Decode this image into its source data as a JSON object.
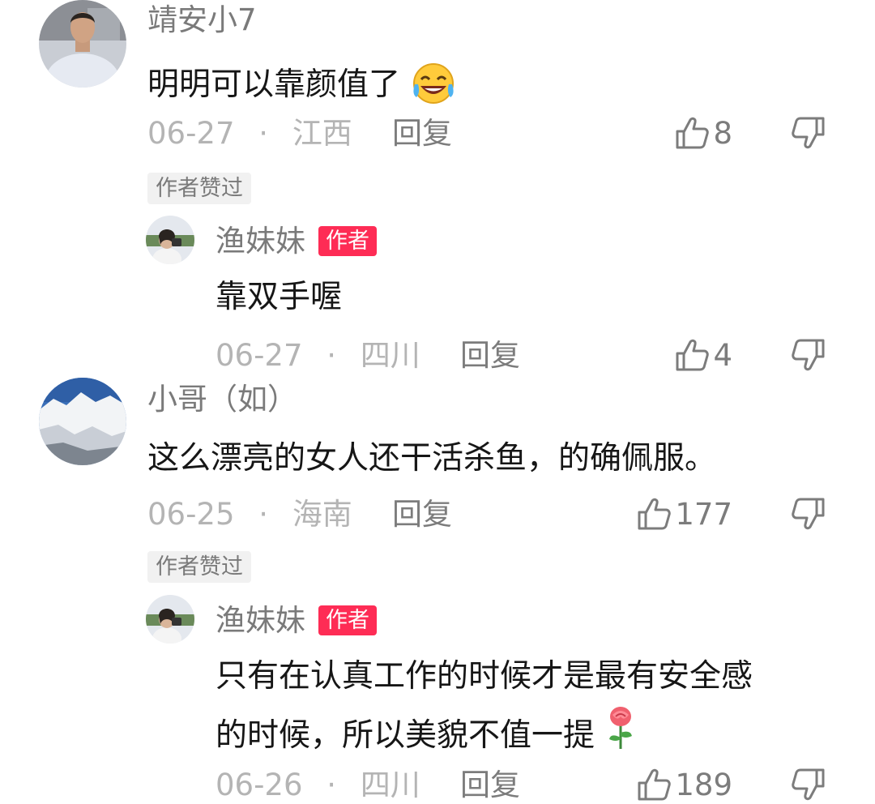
{
  "comments": [
    {
      "username": "靖安小7",
      "text": "明明可以靠颜值了",
      "emoji": "laughing-crying-emoji",
      "date": "06-27",
      "location": "江西",
      "reply_label": "回复",
      "likes": "8",
      "author_liked": "作者赞过",
      "reply": {
        "username": "渔妹妹",
        "author_tag": "作者",
        "text": "靠双手喔",
        "date": "06-27",
        "location": "四川",
        "reply_label": "回复",
        "likes": "4"
      }
    },
    {
      "username": "小哥（如）",
      "text": "这么漂亮的女人还干活杀鱼，的确佩服。",
      "date": "06-25",
      "location": "海南",
      "reply_label": "回复",
      "likes": "177",
      "author_liked": "作者赞过",
      "reply": {
        "username": "渔妹妹",
        "author_tag": "作者",
        "text_line1": "只有在认真工作的时候才是最有安全感",
        "text_line2": "的时候，所以美貌不值一提",
        "emoji": "rose-emoji",
        "date": "06-26",
        "location": "四川",
        "reply_label": "回复",
        "likes": "189"
      }
    }
  ],
  "separator": "·",
  "colors": {
    "author_tag": "#fe2c55",
    "meta": "#b4b4b4",
    "text": "#161616"
  }
}
